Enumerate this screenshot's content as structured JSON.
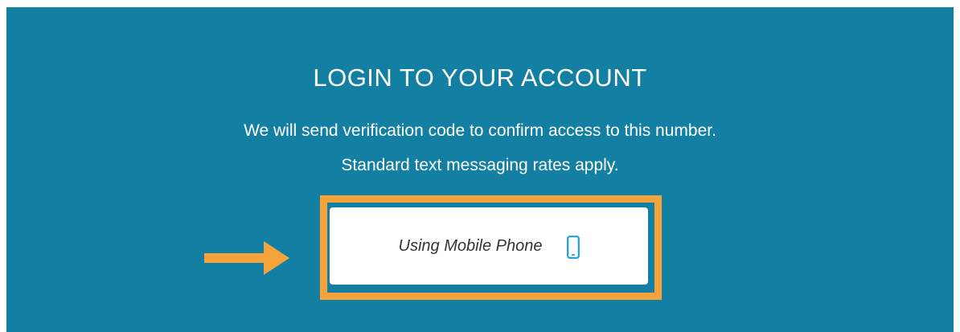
{
  "login": {
    "title": "LOGIN TO YOUR ACCOUNT",
    "subtitle_line1": "We will send verification code to confirm access to this number.",
    "subtitle_line2": "Standard text messaging rates apply."
  },
  "mobile_button": {
    "label": "Using Mobile Phone",
    "icon": "mobile-phone-icon"
  },
  "annotation": {
    "highlight_color": "#f5a33a",
    "arrow_icon": "right-arrow-icon"
  },
  "colors": {
    "panel_background": "#137fa3",
    "button_background": "#ffffff",
    "icon_color": "#1a9fd6"
  }
}
